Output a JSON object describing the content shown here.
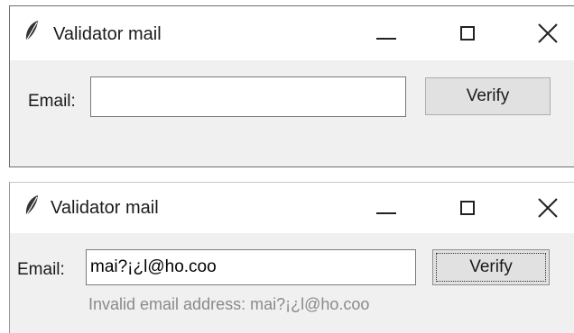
{
  "windows": [
    {
      "title": "Validator mail",
      "email_label": "Email:",
      "email_value": "",
      "verify_label": "Verify",
      "error": ""
    },
    {
      "title": "Validator mail",
      "email_label": "Email:",
      "email_value": "mai?¡¿l@ho.coo",
      "verify_label": "Verify",
      "error": "Invalid email address: mai?¡¿l@ho.coo"
    }
  ],
  "icons": {
    "app": "feather-icon",
    "minimize": "minimize-icon",
    "maximize": "maximize-icon",
    "close": "close-icon"
  },
  "colors": {
    "window_bg": "#f0f0f0",
    "titlebar_bg": "#ffffff",
    "button_bg": "#e1e1e1",
    "error_text": "#8a8a8a"
  }
}
